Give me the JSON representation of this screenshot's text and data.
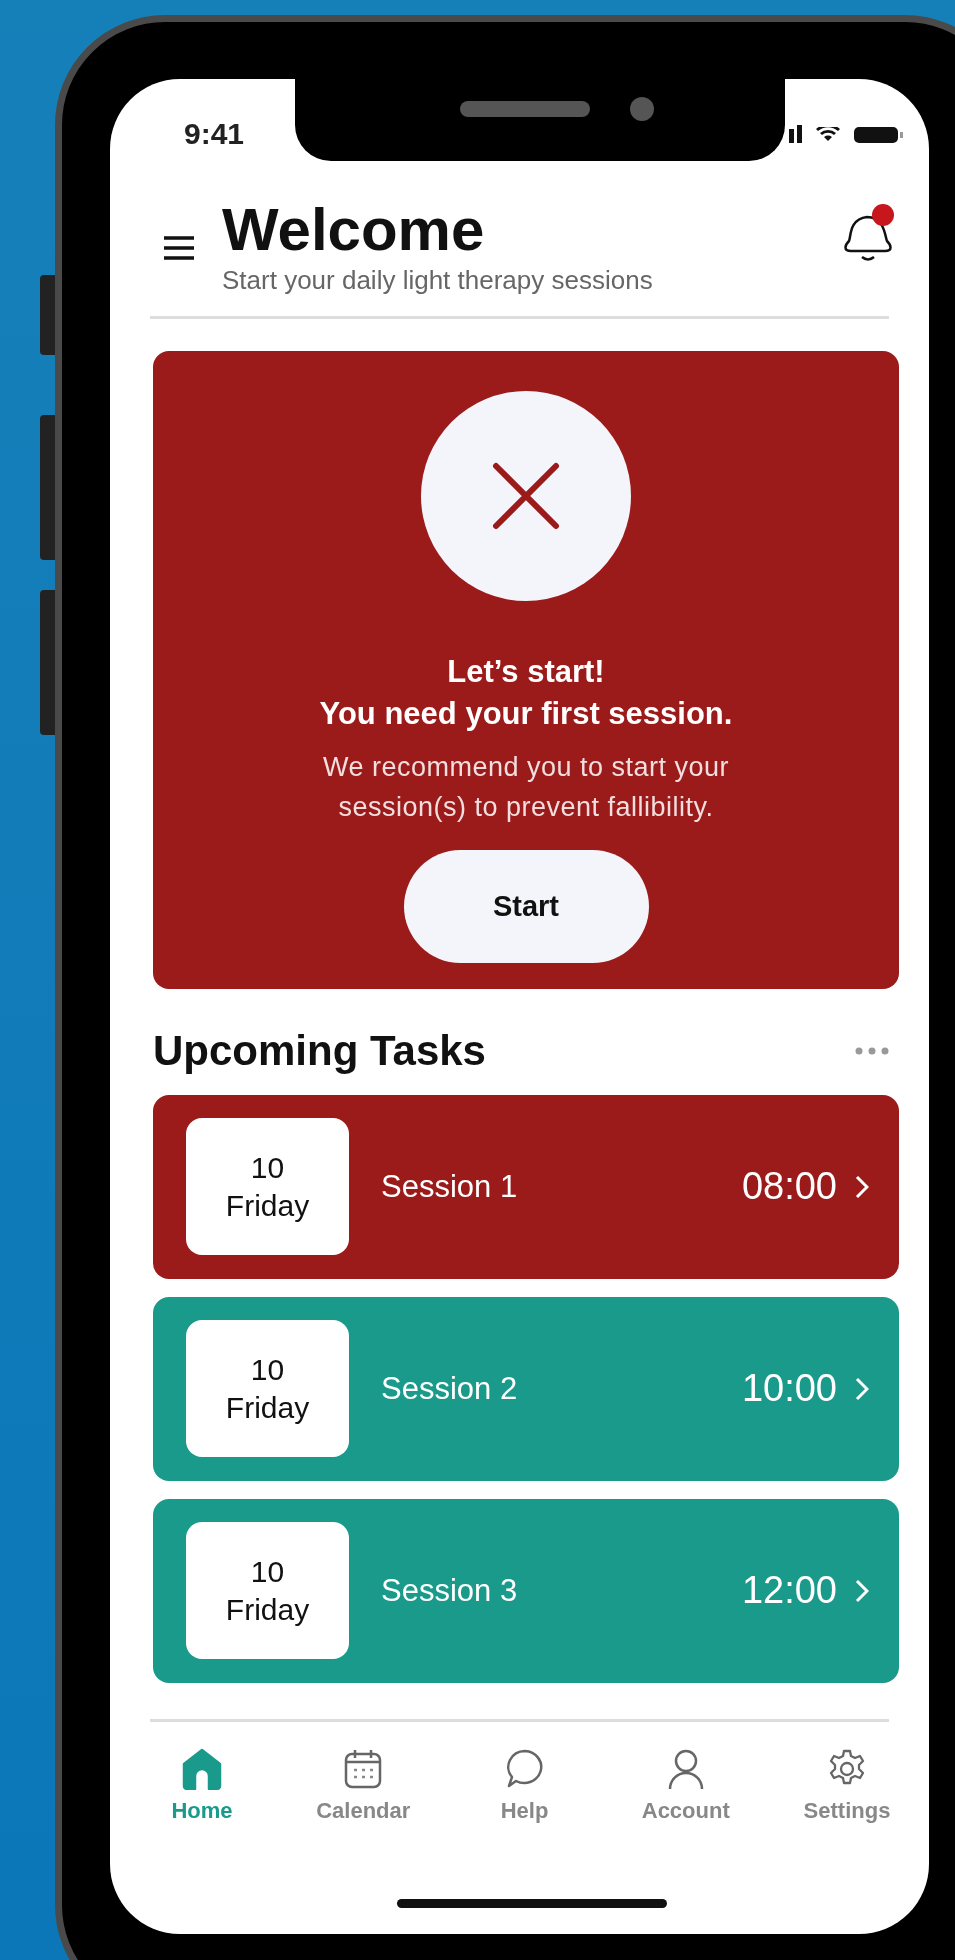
{
  "status_bar": {
    "time": "9:41"
  },
  "header": {
    "title": "Welcome",
    "subtitle": "Start your daily light therapy sessions",
    "notification_badge": true
  },
  "hero": {
    "title_lines": [
      "Let’s start!",
      "You need your first session."
    ],
    "message": "We recommend you to start your session(s) to prevent fallibility.",
    "button": "Start"
  },
  "upcoming": {
    "title": "Upcoming Tasks",
    "tasks": [
      {
        "day": "10",
        "weekday": "Friday",
        "name": "Session 1",
        "time": "08:00",
        "color": "#9b1a1a"
      },
      {
        "day": "10",
        "weekday": "Friday",
        "name": "Session 2",
        "time": "10:00",
        "color": "#1a9a8b"
      },
      {
        "day": "10",
        "weekday": "Friday",
        "name": "Session 3",
        "time": "12:00",
        "color": "#1a9a8b"
      }
    ]
  },
  "tab_bar": [
    {
      "label": "Home",
      "kind": "home",
      "selected": true
    },
    {
      "label": "Calendar",
      "kind": "calendar",
      "selected": false
    },
    {
      "label": "Help",
      "kind": "help",
      "selected": false
    },
    {
      "label": "Account",
      "kind": "account",
      "selected": false
    },
    {
      "label": "Settings",
      "kind": "settings",
      "selected": false
    }
  ]
}
